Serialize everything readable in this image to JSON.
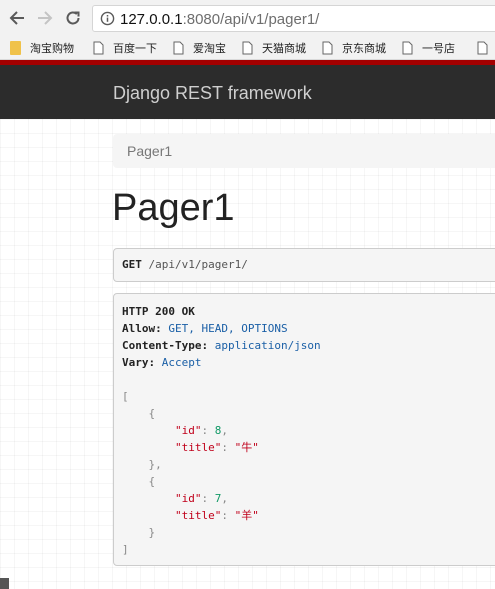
{
  "browser": {
    "url_host": "127.0.0.1",
    "url_rest": ":8080/api/v1/pager1/",
    "bookmarks": [
      {
        "label": "淘宝购物"
      },
      {
        "label": "百度一下"
      },
      {
        "label": "爱淘宝"
      },
      {
        "label": "天猫商城"
      },
      {
        "label": "京东商城"
      },
      {
        "label": "一号店"
      }
    ]
  },
  "navbar": {
    "brand": "Django REST framework"
  },
  "breadcrumb": {
    "current": "Pager1"
  },
  "page": {
    "title": "Pager1"
  },
  "request": {
    "method": "GET",
    "path": "/api/v1/pager1/"
  },
  "response": {
    "status_line": "HTTP 200 OK",
    "headers": [
      {
        "key": "Allow:",
        "value": "GET, HEAD, OPTIONS"
      },
      {
        "key": "Content-Type:",
        "value": "application/json"
      },
      {
        "key": "Vary:",
        "value": "Accept"
      }
    ],
    "items": [
      {
        "id": "8",
        "title": "\"牛\""
      },
      {
        "id": "7",
        "title": "\"羊\""
      }
    ],
    "id_key": "\"id\"",
    "title_key": "\"title\""
  }
}
